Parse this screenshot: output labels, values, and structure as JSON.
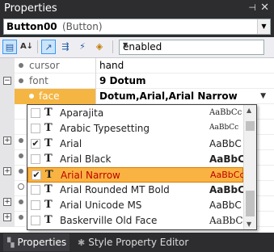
{
  "window": {
    "title": "Properties",
    "pin_glyph": "⊣",
    "close_glyph": "✕"
  },
  "object_selector": {
    "name": "Button00",
    "type": "(Button)"
  },
  "toolbar": {
    "filter_value": "enabled"
  },
  "properties": [
    {
      "name": "cursor",
      "value": "hand"
    },
    {
      "name": "font",
      "value": "9 Dotum"
    },
    {
      "name": "face",
      "value": "Dotum,Arial,Arial Narrow"
    }
  ],
  "font_list": [
    {
      "name": "Aparajita",
      "sample": "AaBbCc",
      "checked": false
    },
    {
      "name": "Arabic Typesetting",
      "sample": "AaBbCc",
      "checked": false
    },
    {
      "name": "Arial",
      "sample": "AaBbC",
      "checked": true
    },
    {
      "name": "Arial Black",
      "sample": "AaBbC",
      "checked": false
    },
    {
      "name": "Arial Narrow",
      "sample": "AaBbCc",
      "checked": true,
      "selected": true
    },
    {
      "name": "Arial Rounded MT Bold",
      "sample": "AaBbC",
      "checked": false
    },
    {
      "name": "Arial Unicode MS",
      "sample": "AaBbC",
      "checked": false
    },
    {
      "name": "Baskerville Old Face",
      "sample": "AaBbC",
      "checked": false
    }
  ],
  "tabs": [
    {
      "label": "Properties"
    },
    {
      "label": "Style Property Editor"
    }
  ]
}
